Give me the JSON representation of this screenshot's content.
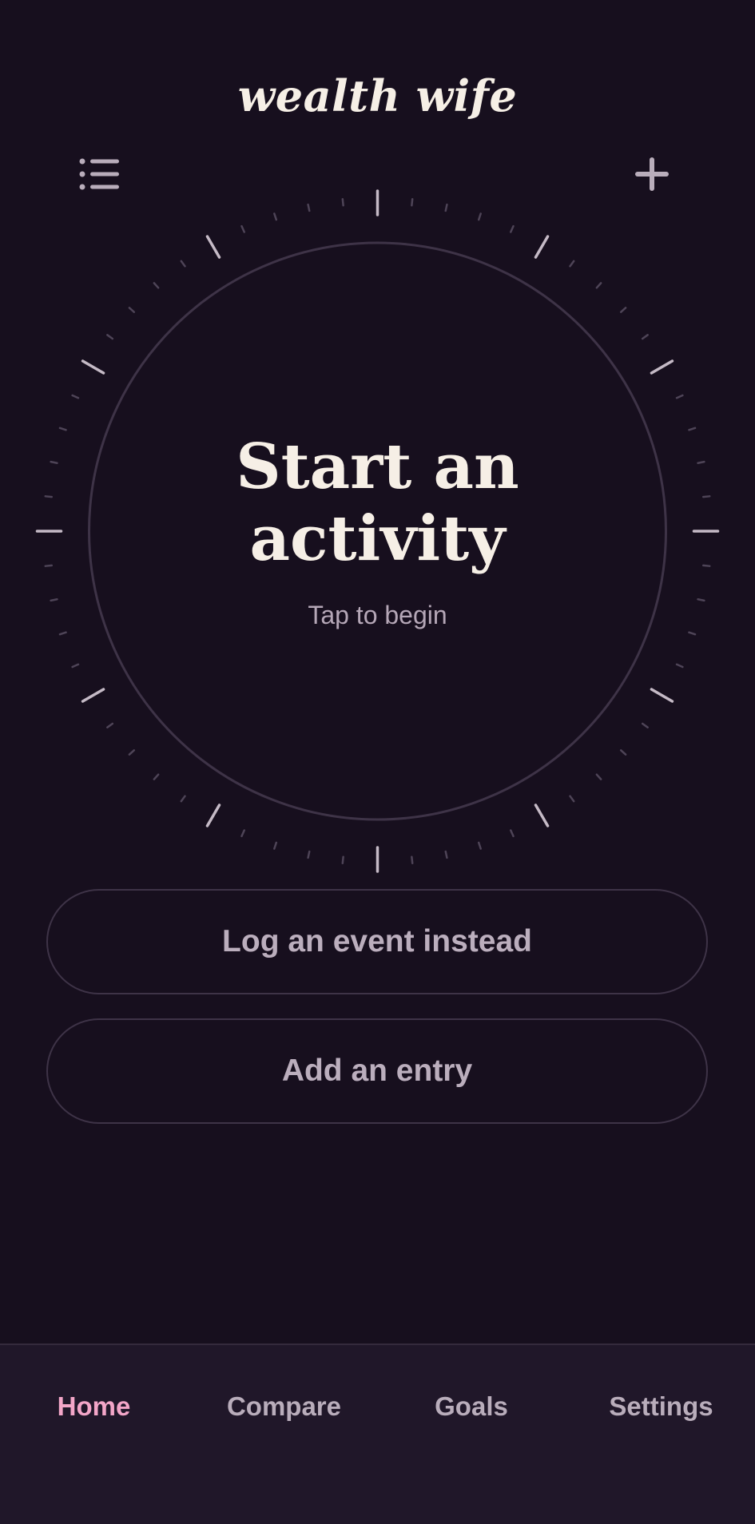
{
  "app": {
    "title": "wealth wife"
  },
  "header": {
    "menu_icon": "list-icon",
    "add_icon": "plus-icon"
  },
  "dial": {
    "heading_line1": "Start an",
    "heading_line2": "activity",
    "subtitle": "Tap to begin"
  },
  "actions": {
    "log_event_label": "Log an event instead",
    "add_entry_label": "Add an entry"
  },
  "tabs": [
    {
      "label": "Home",
      "active": true
    },
    {
      "label": "Compare",
      "active": false
    },
    {
      "label": "Goals",
      "active": false
    },
    {
      "label": "Settings",
      "active": false
    }
  ],
  "colors": {
    "background": "#170f1e",
    "tabbar": "#201729",
    "accent": "#f3a6c8",
    "text_primary": "#f6efe6",
    "text_muted": "#b9adbb",
    "ring": "#3e3347"
  }
}
